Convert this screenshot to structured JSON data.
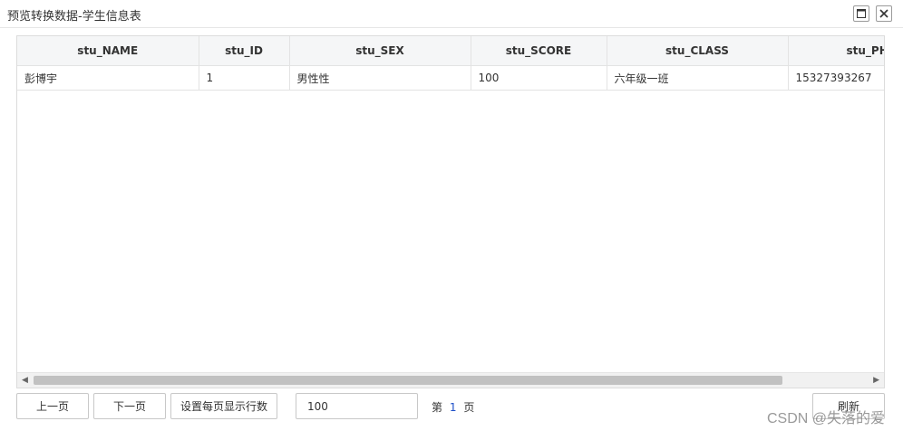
{
  "window": {
    "title": "预览转换数据-学生信息表"
  },
  "table": {
    "columns": [
      "stu_NAME",
      "stu_ID",
      "stu_SEX",
      "stu_SCORE",
      "stu_CLASS",
      "stu_PH"
    ],
    "rows": [
      [
        "彭博宇",
        "1",
        "男性性",
        "100",
        "六年级一班",
        "15327393267"
      ]
    ]
  },
  "pager": {
    "prev_label": "上一页",
    "next_label": "下一页",
    "rows_label": "设置每页显示行数",
    "rows_value": "100",
    "page_prefix": "第",
    "page_num": "1",
    "page_suffix": "页",
    "refresh_label": "刷新"
  },
  "watermark": "CSDN @失落的爱",
  "colors": {
    "header_bg": "#f5f6f7",
    "page_num": "#1e50c8"
  },
  "icons": [
    "maximize-icon",
    "close-icon",
    "scroll-left-icon",
    "scroll-right-icon"
  ]
}
